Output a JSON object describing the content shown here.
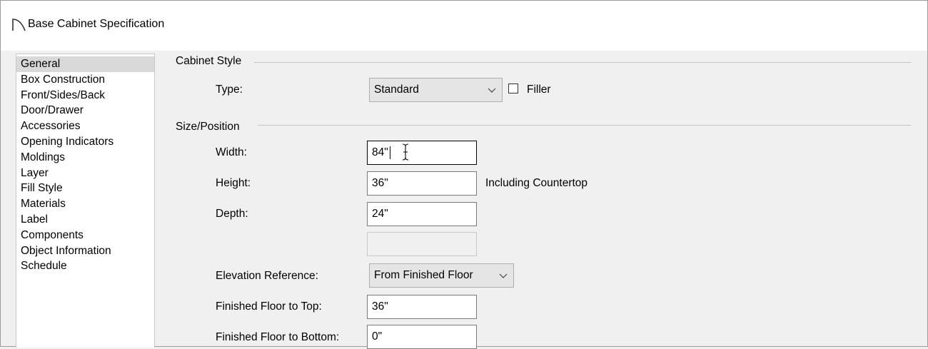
{
  "window": {
    "title": "Base Cabinet Specification"
  },
  "sidebar": {
    "items": [
      {
        "label": "General",
        "active": true
      },
      {
        "label": "Box Construction"
      },
      {
        "label": "Front/Sides/Back"
      },
      {
        "label": "Door/Drawer"
      },
      {
        "label": "Accessories"
      },
      {
        "label": "Opening Indicators"
      },
      {
        "label": "Moldings"
      },
      {
        "label": "Layer"
      },
      {
        "label": "Fill Style"
      },
      {
        "label": "Materials"
      },
      {
        "label": "Label"
      },
      {
        "label": "Components"
      },
      {
        "label": "Object Information"
      },
      {
        "label": "Schedule"
      }
    ]
  },
  "cabinet_style": {
    "section_label": "Cabinet Style",
    "type_label": "Type:",
    "type_value": "Standard",
    "filler_label": "Filler",
    "filler_checked": false
  },
  "size_position": {
    "section_label": "Size/Position",
    "width_label": "Width:",
    "width_value": "84\"",
    "height_label": "Height:",
    "height_value": "36\"",
    "height_note": "Including Countertop",
    "depth_label": "Depth:",
    "depth_value": "24\"",
    "elevation_ref_label": "Elevation Reference:",
    "elevation_ref_value": "From Finished Floor",
    "ff_top_label": "Finished Floor to Top:",
    "ff_top_value": "36\"",
    "ff_bottom_label": "Finished Floor to Bottom:",
    "ff_bottom_value": "0\""
  },
  "icons": {
    "title_icon": "cabinet-arc-icon",
    "dropdown": "chevron-down-icon",
    "cursor": "text-cursor-icon"
  }
}
